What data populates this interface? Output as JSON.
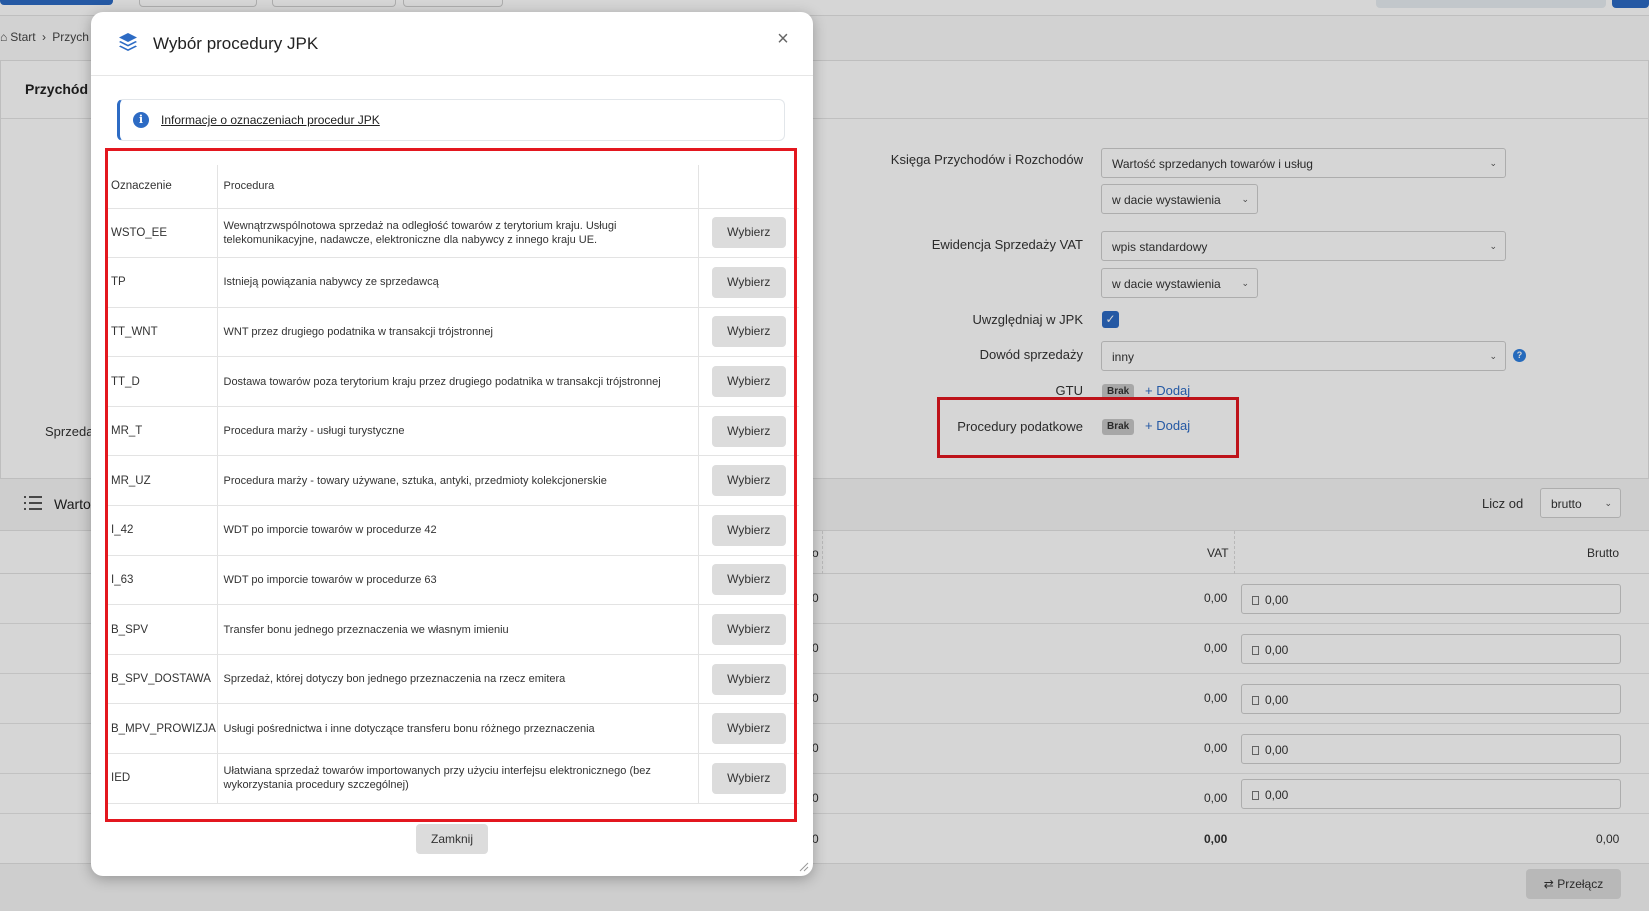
{
  "breadcrumb": {
    "start": "Start",
    "current": "Przych"
  },
  "background": {
    "card_title": "Przychód",
    "left_label": "Sprzeda",
    "form": {
      "ksiega_label": "Księga Przychodów i Rozchodów",
      "ksiega_value": "Wartość sprzedanych towarów i usług",
      "ksiega_date": "w dacie wystawienia",
      "vat_label": "Ewidencja Sprzedaży VAT",
      "vat_value": "wpis standardowy",
      "vat_date": "w dacie wystawienia",
      "jpk_label": "Uwzględniaj w JPK",
      "dowod_label": "Dowód sprzedaży",
      "dowod_value": "inny",
      "gtu_label": "GTU",
      "gtu_badge": "Brak",
      "gtu_add": "+ Dodaj",
      "proc_label": "Procedury podatkowe",
      "proc_badge": "Brak",
      "proc_add": "+ Dodaj"
    },
    "section": {
      "title": "Warto",
      "licz_od_label": "Licz od",
      "licz_od_value": "brutto"
    },
    "table": {
      "col_vat": "VAT",
      "col_brutto": "Brutto",
      "rows": [
        {
          "left": "0",
          "vat": "0,00",
          "brutto": "0,00"
        },
        {
          "left": "0",
          "vat": "0,00",
          "brutto": "0,00"
        },
        {
          "left": "0",
          "vat": "0,00",
          "brutto": "0,00"
        },
        {
          "left": "0",
          "vat": "0,00",
          "brutto": "0,00"
        },
        {
          "left": "0",
          "vat": "0,00",
          "brutto": "0,00"
        }
      ],
      "sum": {
        "left": "0",
        "vat": "0,00",
        "brutto": "0,00"
      }
    },
    "switch_button": "Przełącz"
  },
  "modal": {
    "title": "Wybór procedury JPK",
    "close_icon": "×",
    "info_link": "Informacje o oznaczeniach procedur JPK",
    "col_code": "Oznaczenie",
    "col_procedure": "Procedura",
    "pick_label": "Wybierz",
    "rows": [
      {
        "code": "WSTO_EE",
        "desc": "Wewnątrzwspólnotowa sprzedaż na odległość towarów z terytorium kraju. Usługi telekomunikacyjne, nadawcze, elektroniczne dla nabywcy z innego kraju UE."
      },
      {
        "code": "TP",
        "desc": "Istnieją powiązania nabywcy ze sprzedawcą"
      },
      {
        "code": "TT_WNT",
        "desc": "WNT przez drugiego podatnika w transakcji trójstronnej"
      },
      {
        "code": "TT_D",
        "desc": "Dostawa towarów poza terytorium kraju przez drugiego podatnika w transakcji trójstronnej"
      },
      {
        "code": "MR_T",
        "desc": "Procedura marży - usługi turystyczne"
      },
      {
        "code": "MR_UZ",
        "desc": "Procedura marży - towary używane, sztuka, antyki, przedmioty kolekcjonerskie"
      },
      {
        "code": "I_42",
        "desc": "WDT po imporcie towarów w procedurze 42"
      },
      {
        "code": "I_63",
        "desc": "WDT po imporcie towarów w procedurze 63"
      },
      {
        "code": "B_SPV",
        "desc": "Transfer bonu jednego przeznaczenia we własnym imieniu"
      },
      {
        "code": "B_SPV_DOSTAWA",
        "desc": "Sprzedaż, której dotyczy bon jednego przeznaczenia na rzecz emitera"
      },
      {
        "code": "B_MPV_PROWIZJA",
        "desc": "Usługi pośrednictwa i inne dotyczące transferu bonu różnego przeznaczenia"
      },
      {
        "code": "IED",
        "desc": "Ułatwiana sprzedaż towarów importowanych przy użyciu interfejsu elektronicznego (bez wykorzystania procedury szczególnej)"
      }
    ],
    "close_button": "Zamknij"
  },
  "colors": {
    "accent": "#2d6bc4",
    "highlight": "#e3171f"
  },
  "icons": [
    "stack-icon",
    "close-icon",
    "info-icon",
    "list-icon",
    "check-icon",
    "help-icon",
    "calculator-icon",
    "switch-icon",
    "home-icon",
    "chevron-down-icon"
  ]
}
